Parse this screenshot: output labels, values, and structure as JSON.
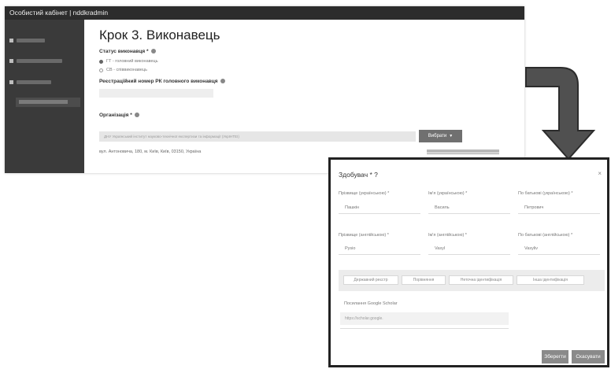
{
  "app": {
    "window_title": "Особистий кабінет | nddkradmin",
    "step_title": "Крок 3. Виконавець",
    "executor_status_label": "Статус виконавця *",
    "status_options": [
      {
        "label": "ГТ - головний виконавець",
        "selected": true
      },
      {
        "label": "СВ - співвиконавець",
        "selected": false
      }
    ],
    "reg_number_label": "Реєстраційний номер РК головного виконавця",
    "organization_label": "Організація *",
    "organization_value": "ДНУ Український інститут науково-технічної експертизи та інформації (УкрІНТЕІ)",
    "choose_button": "Вибрати",
    "address": "вул. Антоновича, 180, м. Київ, Київ, 03150, Україна"
  },
  "modal": {
    "title": "Здобувач * ?",
    "close": "×",
    "labels_ukr": [
      "Прізвище (українською) *",
      "Ім'я (українською) *",
      "По батькові (українською) *"
    ],
    "values_ukr": [
      "Пашкін",
      "Василь",
      "Петрович"
    ],
    "labels_eng": [
      "Прізвище (англійською) *",
      "Ім'я (англійською) *",
      "По батькові (англійською) *"
    ],
    "values_eng": [
      "Pysio",
      "Vasyl",
      "Vasyliv"
    ],
    "tabs": [
      "Державний реєстр",
      "Порівняння",
      "Неточна ідентифікація",
      "Інша ідентифікація"
    ],
    "profile_link_label": "Посилання Google Scholar",
    "profile_link_placeholder": "https://scholar.google.",
    "save_button": "Зберегти",
    "cancel_button": "Скасувати"
  },
  "colors": {
    "topbar": "#2c2c2c",
    "sidebar": "#3a3a3a",
    "button": "#707070",
    "arrow": "#505050"
  }
}
